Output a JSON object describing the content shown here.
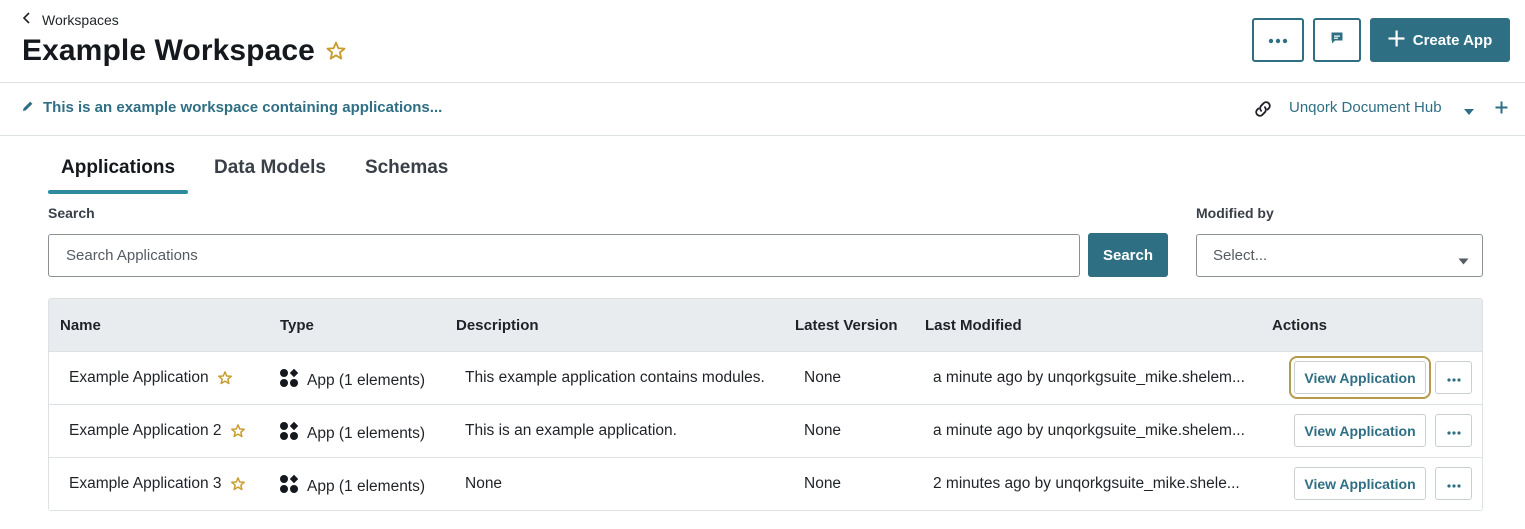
{
  "header": {
    "back_label": "Workspaces",
    "title": "Example Workspace",
    "create_label": "Create App"
  },
  "description_bar": {
    "text": "This is an example workspace containing applications...",
    "hub_label": "Unqork Document Hub"
  },
  "tabs": [
    {
      "label": "Applications",
      "active": true
    },
    {
      "label": "Data Models",
      "active": false
    },
    {
      "label": "Schemas",
      "active": false
    }
  ],
  "search": {
    "label": "Search",
    "placeholder": "Search Applications",
    "button_label": "Search"
  },
  "modified_by": {
    "label": "Modified by",
    "placeholder": "Select..."
  },
  "table": {
    "columns": [
      "Name",
      "Type",
      "Description",
      "Latest Version",
      "Last Modified",
      "Actions"
    ],
    "rows": [
      {
        "name": "Example Application",
        "type": "App (1 elements)",
        "description": "This example application contains modules.",
        "latest_version": "None",
        "last_modified": "a minute ago by unqorkgsuite_mike.shelem...",
        "action_label": "View Application"
      },
      {
        "name": "Example Application 2",
        "type": "App (1 elements)",
        "description": "This is an example application.",
        "latest_version": "None",
        "last_modified": "a minute ago by unqorkgsuite_mike.shelem...",
        "action_label": "View Application"
      },
      {
        "name": "Example Application 3",
        "type": "App (1 elements)",
        "description": "None",
        "latest_version": "None",
        "last_modified": "2 minutes ago by unqorkgsuite_mike.shele...",
        "action_label": "View Application"
      }
    ]
  },
  "colors": {
    "primary": "#2f6f84",
    "accent_tab": "#2f8a9e",
    "star": "#c89b2c",
    "focus_outline": "#b59a4a"
  }
}
